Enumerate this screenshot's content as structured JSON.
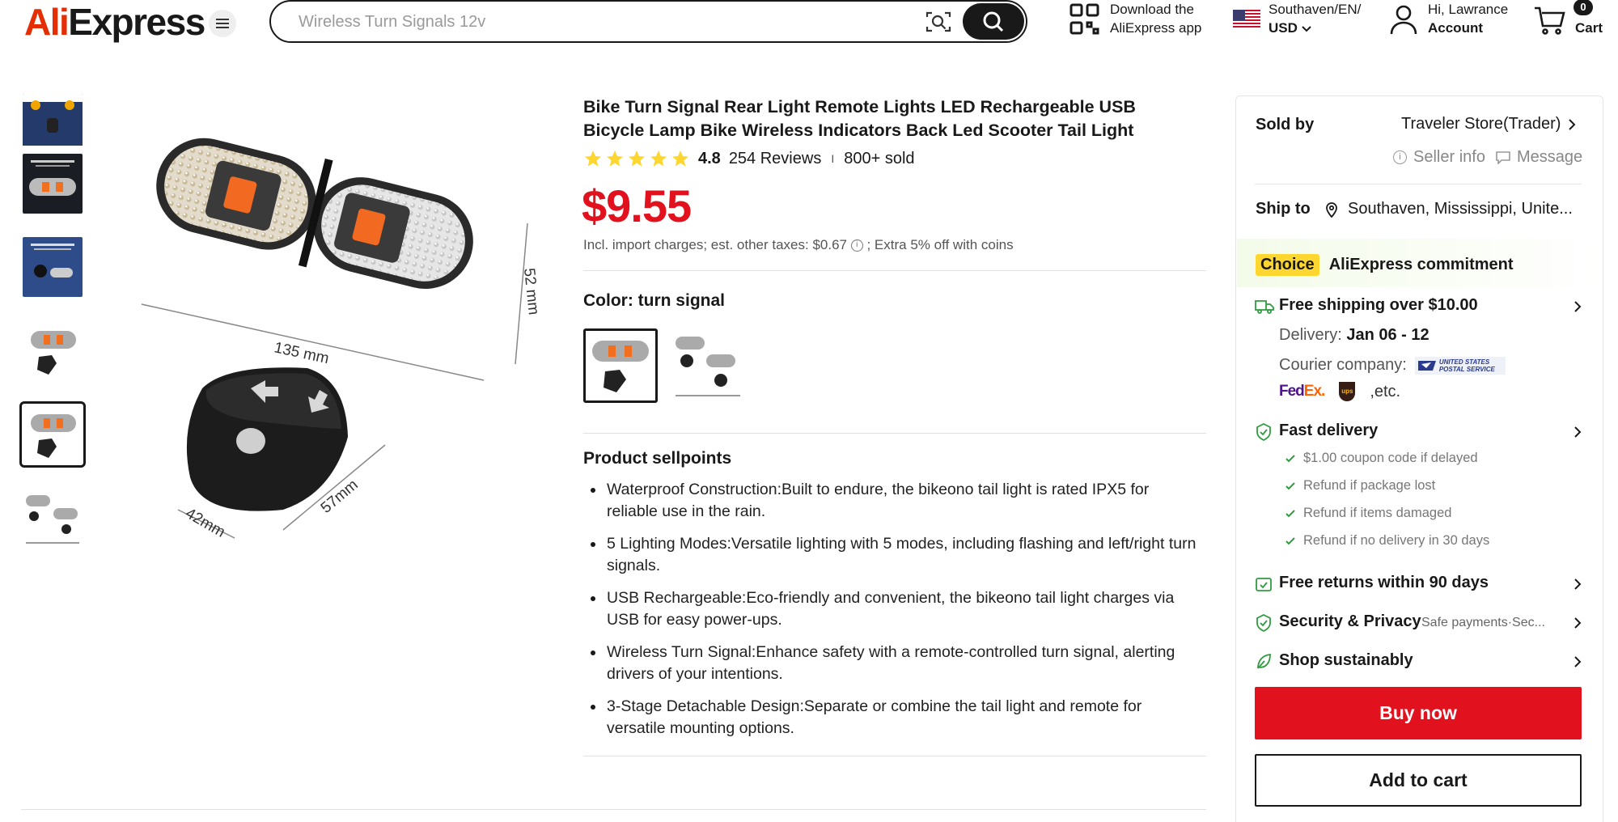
{
  "header": {
    "logo": {
      "part1": "Ali",
      "part2": "Express"
    },
    "search": {
      "placeholder": "Wireless Turn Signals 12v"
    },
    "app_download": {
      "line1": "Download the",
      "line2": "AliExpress app"
    },
    "locale": {
      "line1": "Southaven/EN/",
      "line2": "USD"
    },
    "account": {
      "line1": "Hi, Lawrance",
      "line2": "Account"
    },
    "cart": {
      "label": "Cart",
      "count": "0"
    }
  },
  "product": {
    "title": "Bike Turn Signal Rear Light Remote Lights LED Rechargeable USB Bicycle Lamp Bike Wireless Indicators Back Led Scooter Tail Light",
    "rating": "4.8",
    "reviews": "254 Reviews",
    "sep": "I",
    "sold": "800+ sold",
    "price": "$9.55",
    "tax_note": "Incl. import charges; est. other taxes: $0.67",
    "tax_note_suffix": "; Extra 5% off with coins",
    "color_label": "Color: turn signal",
    "image_dims": {
      "length": "135 mm",
      "height": "52 mm",
      "remote_w": "42mm",
      "remote_h": "57mm"
    },
    "sellpoints_title": "Product sellpoints",
    "sellpoints": [
      "Waterproof Construction:Built to endure, the bikeono tail light is rated IPX5 for reliable use in the rain.",
      "5 Lighting Modes:Versatile lighting with 5 modes, including flashing and left/right turn signals.",
      "USB Rechargeable:Eco-friendly and convenient, the bikeono tail light charges via USB for easy power-ups.",
      "Wireless Turn Signal:Enhance safety with a remote-controlled turn signal, alerting drivers of your intentions.",
      "3-Stage Detachable Design:Separate or combine the tail light and remote for versatile mounting options."
    ]
  },
  "panel": {
    "sold_by_label": "Sold by",
    "store": "Traveler Store(Trader)",
    "seller_info": "Seller info",
    "message": "Message",
    "ship_to_label": "Ship to",
    "ship_to": "Southaven, Mississippi, Unite...",
    "choice_badge": "Choice",
    "commitment": "AliExpress commitment",
    "free_shipping": "Free shipping over $10.00",
    "delivery_label": "Delivery:",
    "delivery_dates": "Jan 06 - 12",
    "courier_label": "Courier company:",
    "usps": "UNITED STATES POSTAL SERVICE",
    "fedex_a": "Fed",
    "fedex_b": "Ex.",
    "ups": "ups",
    "etc": ",etc.",
    "fast_delivery": "Fast delivery",
    "guarantees": [
      "$1.00 coupon code if delayed",
      "Refund if package lost",
      "Refund if items damaged",
      "Refund if no delivery in 30 days"
    ],
    "free_returns": "Free returns within 90 days",
    "security": "Security & Privacy",
    "security_sub": "Safe payments·Sec...",
    "sustainable": "Shop sustainably",
    "buy_now": "Buy now",
    "add_to_cart": "Add to cart"
  },
  "colors": {
    "brand_red": "#e2111e",
    "star": "#fdd72f",
    "choice_yellow": "#fdd72f",
    "green": "#2e9c3f"
  }
}
